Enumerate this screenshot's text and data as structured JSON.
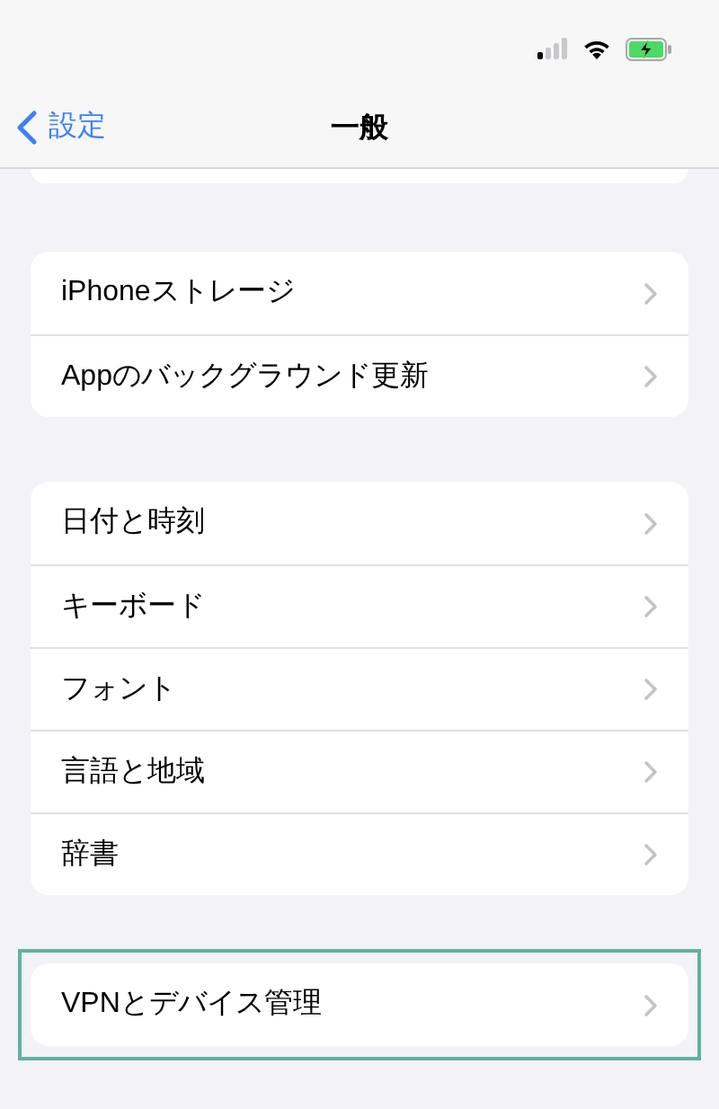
{
  "nav": {
    "back_label": "設定",
    "title": "一般"
  },
  "groups": [
    {
      "highlighted": false,
      "items": [
        {
          "label": "iPhoneストレージ"
        },
        {
          "label": "Appのバックグラウンド更新"
        }
      ]
    },
    {
      "highlighted": false,
      "items": [
        {
          "label": "日付と時刻"
        },
        {
          "label": "キーボード"
        },
        {
          "label": "フォント"
        },
        {
          "label": "言語と地域"
        },
        {
          "label": "辞書"
        }
      ]
    },
    {
      "highlighted": true,
      "items": [
        {
          "label": "VPNとデバイス管理"
        }
      ]
    }
  ]
}
